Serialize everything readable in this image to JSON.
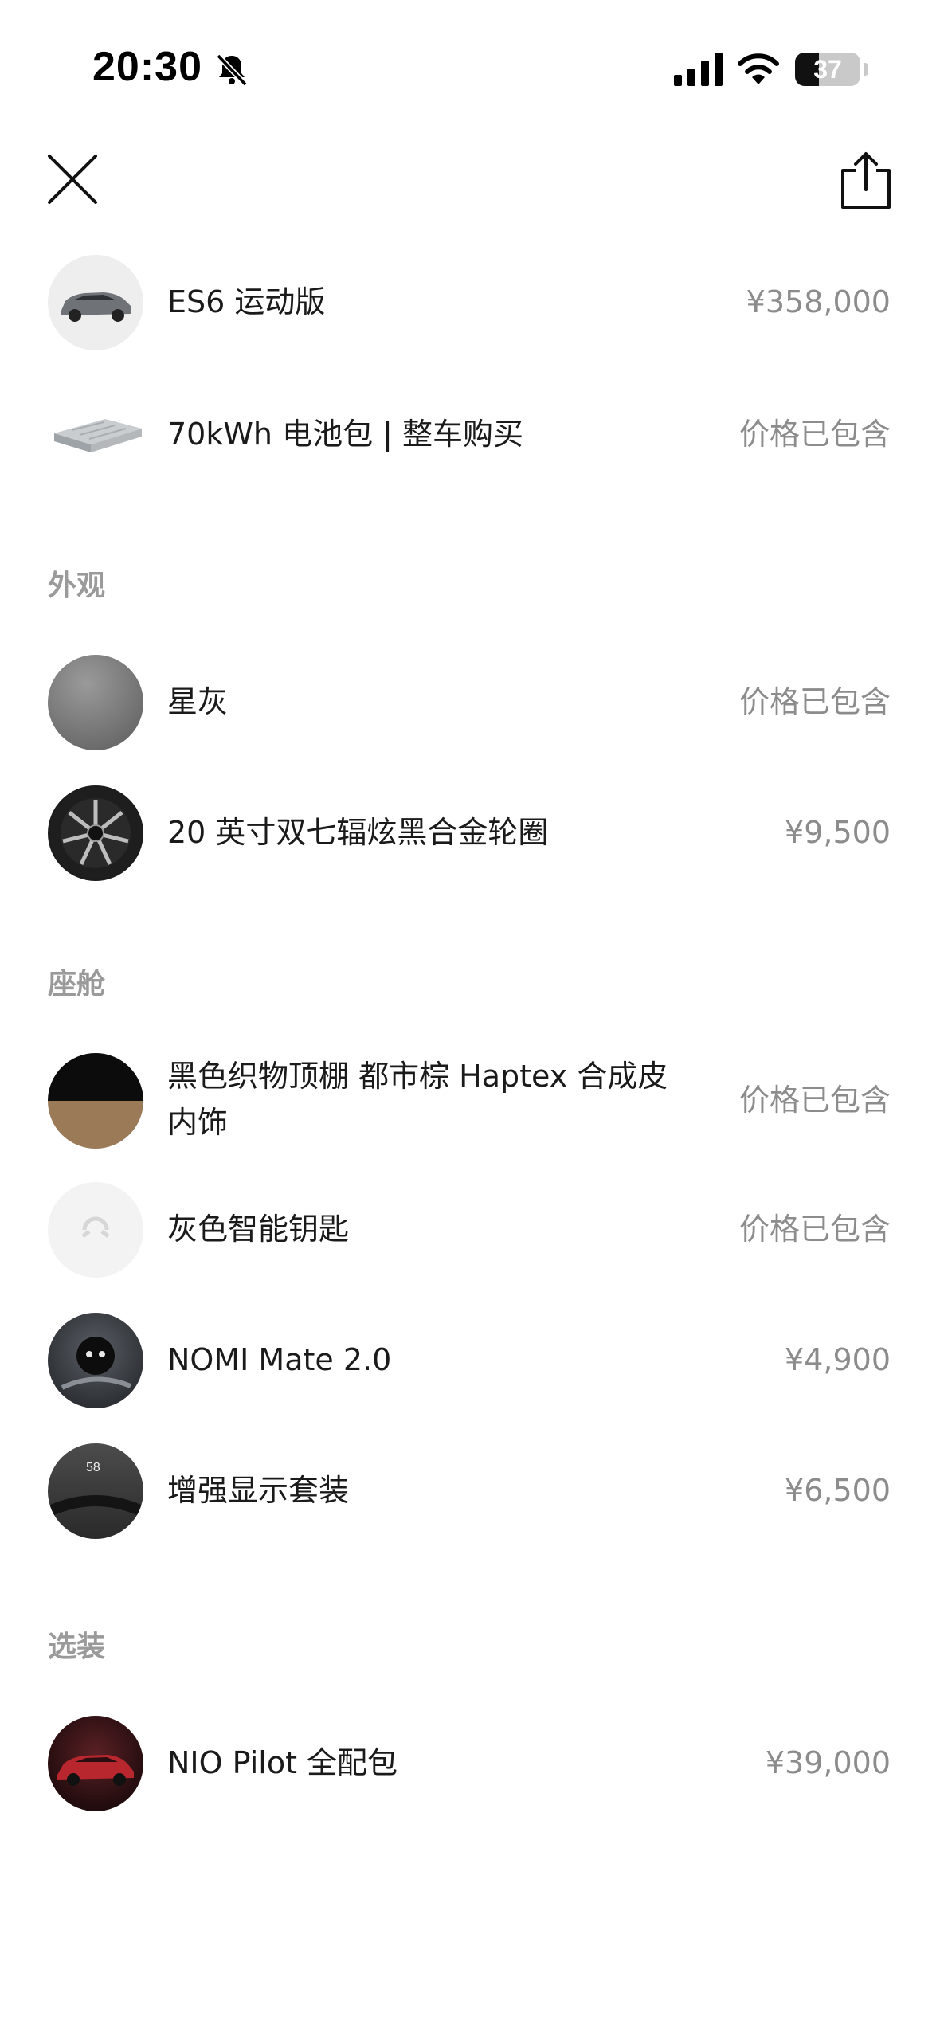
{
  "status_bar": {
    "time": "20:30",
    "battery_level": 37,
    "battery_text": "37"
  },
  "header": {
    "close_icon": "close-icon",
    "share_icon": "share-icon"
  },
  "top_items": [
    {
      "name": "ES6 运动版",
      "price": "¥358,000",
      "thumb": "car-thumb"
    },
    {
      "name": "70kWh 电池包 | 整车购买",
      "price": "价格已包含",
      "thumb": "battery-pack-thumb"
    }
  ],
  "sections": [
    {
      "title": "外观",
      "items": [
        {
          "name": "星灰",
          "price": "价格已包含",
          "thumb": "grey-color-swatch"
        },
        {
          "name": "20 英寸双七辐炫黑合金轮圈",
          "price": "¥9,500",
          "thumb": "wheel-thumb"
        }
      ]
    },
    {
      "title": "座舱",
      "items": [
        {
          "name_line1": "黑色织物顶棚 都市棕 Haptex 合成皮",
          "name_line2": "内饰",
          "price": "价格已包含",
          "thumb": "interior-swatch"
        },
        {
          "name": "灰色智能钥匙",
          "price": "价格已包含",
          "thumb": "key-thumb"
        },
        {
          "name": "NOMI Mate 2.0",
          "price": "¥4,900",
          "thumb": "nomi-thumb"
        },
        {
          "name": "增强显示套装",
          "price": "¥6,500",
          "thumb": "display-thumb",
          "thumb_text": "58"
        }
      ]
    },
    {
      "title": "选装",
      "items": [
        {
          "name": "NIO Pilot 全配包",
          "price": "¥39,000",
          "thumb": "red-car-thumb"
        }
      ]
    }
  ],
  "colors": {
    "text": "#1a1a1a",
    "muted": "#8c8c8c",
    "section": "#9a9a9a"
  }
}
